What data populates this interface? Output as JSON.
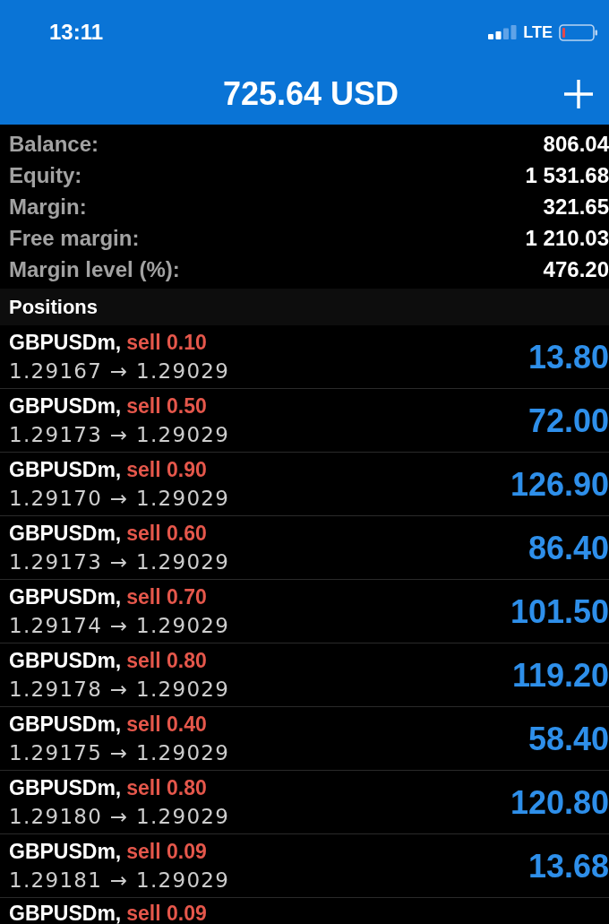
{
  "status_bar": {
    "time": "13:11",
    "network": "LTE"
  },
  "header": {
    "title": "725.64 USD"
  },
  "summary": [
    {
      "label": "Balance:",
      "value": "806.04"
    },
    {
      "label": "Equity:",
      "value": "1 531.68"
    },
    {
      "label": "Margin:",
      "value": "321.65"
    },
    {
      "label": "Free margin:",
      "value": "1 210.03"
    },
    {
      "label": "Margin level (%):",
      "value": "476.20"
    }
  ],
  "positions": {
    "title": "Positions",
    "items": [
      {
        "symbol": "GBPUSDm,",
        "order": "sell 0.10",
        "prices": "1.29167 → 1.29029",
        "profit": "13.80"
      },
      {
        "symbol": "GBPUSDm,",
        "order": "sell 0.50",
        "prices": "1.29173 → 1.29029",
        "profit": "72.00"
      },
      {
        "symbol": "GBPUSDm,",
        "order": "sell 0.90",
        "prices": "1.29170 → 1.29029",
        "profit": "126.90"
      },
      {
        "symbol": "GBPUSDm,",
        "order": "sell 0.60",
        "prices": "1.29173 → 1.29029",
        "profit": "86.40"
      },
      {
        "symbol": "GBPUSDm,",
        "order": "sell 0.70",
        "prices": "1.29174 → 1.29029",
        "profit": "101.50"
      },
      {
        "symbol": "GBPUSDm,",
        "order": "sell 0.80",
        "prices": "1.29178 → 1.29029",
        "profit": "119.20"
      },
      {
        "symbol": "GBPUSDm,",
        "order": "sell 0.40",
        "prices": "1.29175 → 1.29029",
        "profit": "58.40"
      },
      {
        "symbol": "GBPUSDm,",
        "order": "sell 0.80",
        "prices": "1.29180 → 1.29029",
        "profit": "120.80"
      },
      {
        "symbol": "GBPUSDm,",
        "order": "sell 0.09",
        "prices": "1.29181 → 1.29029",
        "profit": "13.68"
      },
      {
        "symbol": "GBPUSDm,",
        "order": "sell 0.09"
      }
    ]
  }
}
